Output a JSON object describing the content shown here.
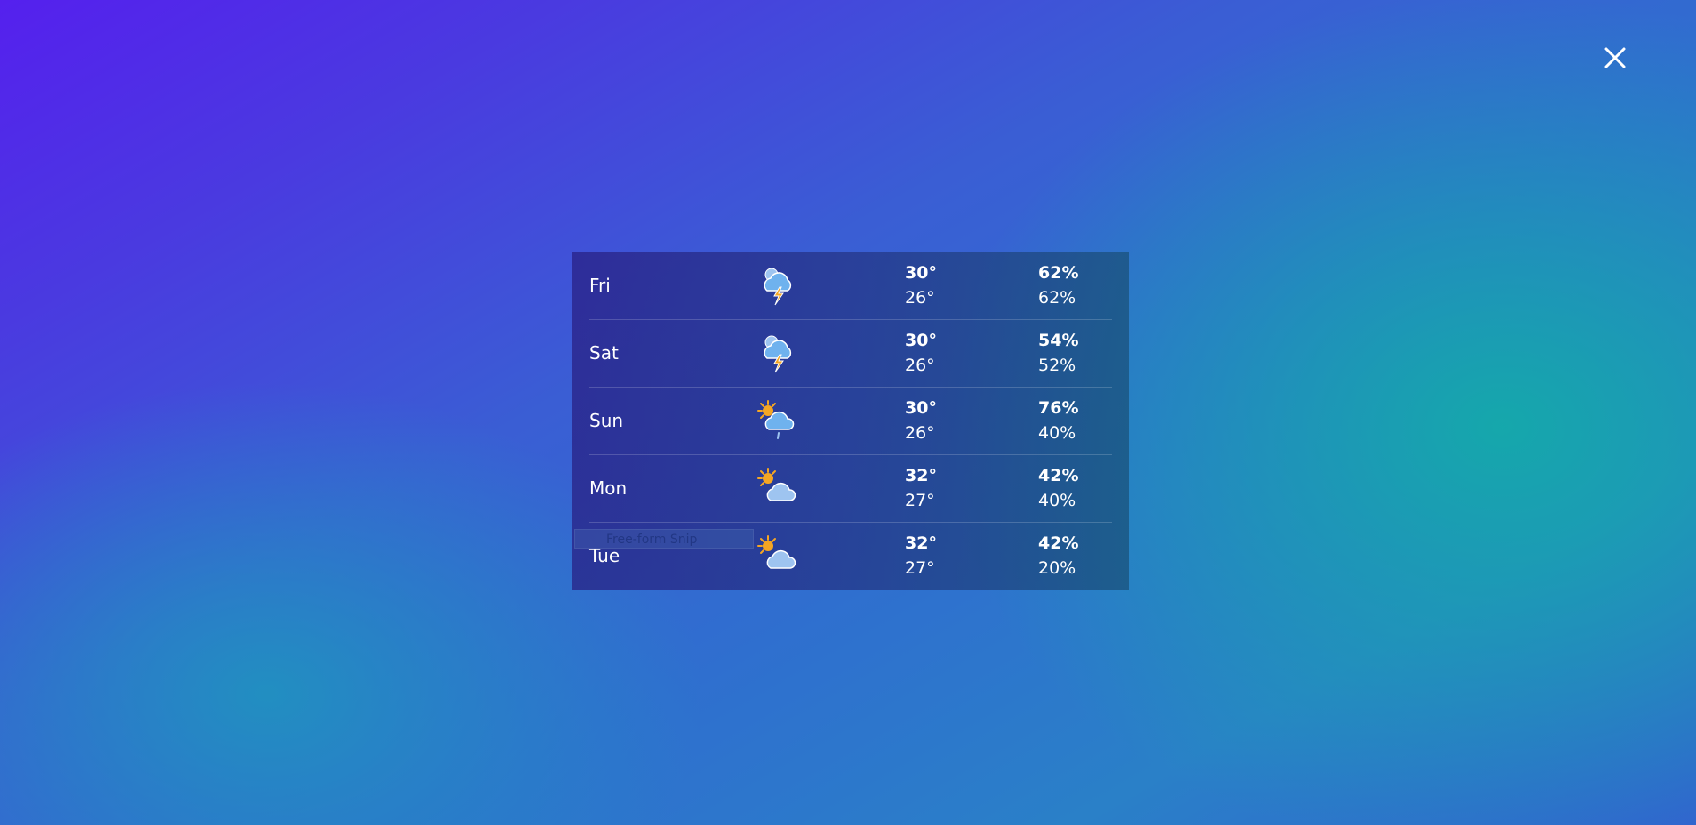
{
  "close_icon": "close-icon",
  "snip_tooltip": "Free-form Snip",
  "forecast": [
    {
      "day": "Fri",
      "icon": "thunderstorm-icon",
      "high": "30°",
      "low": "26°",
      "hum_high": "62%",
      "hum_low": "62%"
    },
    {
      "day": "Sat",
      "icon": "thunderstorm-icon",
      "high": "30°",
      "low": "26°",
      "hum_high": "54%",
      "hum_low": "52%"
    },
    {
      "day": "Sun",
      "icon": "sun-cloud-rain-icon",
      "high": "30°",
      "low": "26°",
      "hum_high": "76%",
      "hum_low": "40%"
    },
    {
      "day": "Mon",
      "icon": "partly-cloudy-icon",
      "high": "32°",
      "low": "27°",
      "hum_high": "42%",
      "hum_low": "40%"
    },
    {
      "day": "Tue",
      "icon": "partly-cloudy-icon",
      "high": "32°",
      "low": "27°",
      "hum_high": "42%",
      "hum_low": "20%"
    }
  ]
}
